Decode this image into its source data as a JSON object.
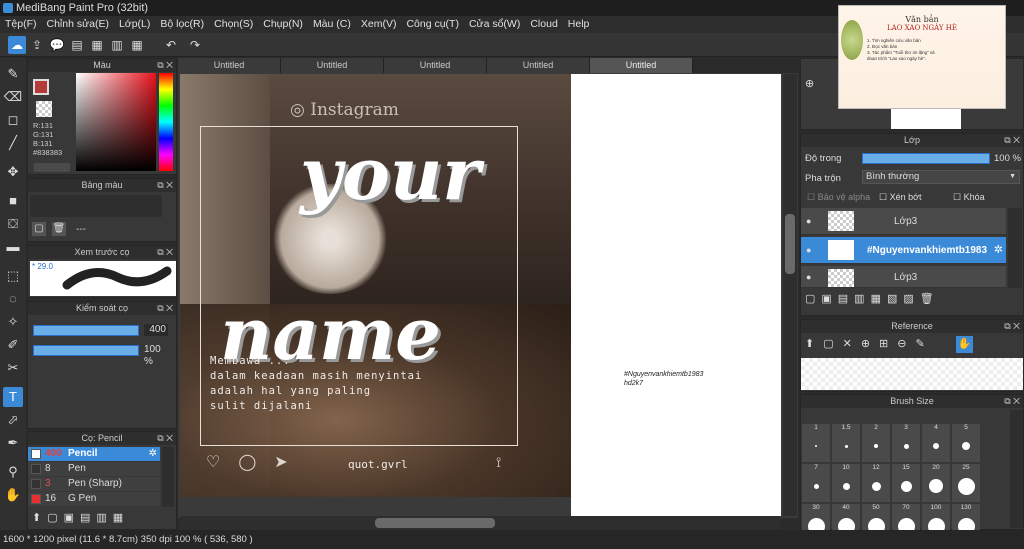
{
  "app": {
    "title": "MediBang Paint Pro (32bit)"
  },
  "menu": [
    "Tệp(F)",
    "Chỉnh sửa(E)",
    "Lớp(L)",
    "Bộ lọc(R)",
    "Chọn(S)",
    "Chụp(N)",
    "Màu (C)",
    "Xem(V)",
    "Công cụ(T)",
    "Cửa sổ(W)",
    "Cloud",
    "Help"
  ],
  "tabs": [
    "Untitled",
    "Untitled",
    "Untitled",
    "Untitled",
    "Untitled"
  ],
  "color_panel": {
    "title": "Màu",
    "r": "R:131",
    "g": "G:131",
    "b": "B:131",
    "hex": "#838383",
    "color": "#838383"
  },
  "palette_panel": {
    "title": "Bảng màu",
    "dashes": "---"
  },
  "preview_panel": {
    "title": "Xem trước cọ",
    "size": "29.0"
  },
  "control_panel": {
    "title": "Kiểm soát cọ",
    "size": "400",
    "opacity": "100 %"
  },
  "brush_panel": {
    "title": "Cọ: Pencil",
    "items": [
      {
        "size": "400",
        "name": "Pencil",
        "color": "#ffffff",
        "active": true
      },
      {
        "size": "8",
        "name": "Pen",
        "color": "#ffffff",
        "active": false
      },
      {
        "size": "3",
        "name": "Pen (Sharp)",
        "color": "#ffffff",
        "active": false
      },
      {
        "size": "16",
        "name": "G Pen",
        "color": "#e83030",
        "active": false
      }
    ]
  },
  "canvas": {
    "instagram": "Instagram",
    "word1": "your",
    "word2": "name",
    "quote": [
      "Membawa  ...",
      "dalam  keadaan  masih  menyintai",
      "adalah  hal  yang  paling",
      "sulit  dijalani"
    ],
    "handle": "quot.gvrl",
    "note": [
      "#Nguyenvankhiemtb1983",
      "hd2k7"
    ]
  },
  "layer_panel": {
    "title": "Lớp",
    "opacity_label": "Độ trong",
    "opacity": "100 %",
    "blend_label": "Pha trộn",
    "blend": "Bình thường",
    "protect": "Bảo vệ alpha",
    "clip": "Xén bớt",
    "lock": "Khóa",
    "layers": [
      {
        "name": "Lớp3",
        "active": false
      },
      {
        "name": "#Nguyenvankhiemtb1983",
        "active": true
      },
      {
        "name": "Lớp3",
        "active": false
      }
    ]
  },
  "reference_panel": {
    "title": "Reference"
  },
  "brushsize_panel": {
    "title": "Brush Size",
    "row1": [
      "1",
      "1.5",
      "2",
      "3",
      "4",
      "5"
    ],
    "row2": [
      "7",
      "10",
      "12",
      "15",
      "20",
      "25"
    ],
    "row3": [
      "30",
      "40",
      "50",
      "70",
      "100",
      "130"
    ]
  },
  "popup": {
    "title": "Văn bản",
    "subtitle": "LAO XAO NGÀY HÈ",
    "lines": [
      "1. Tìm nghiên cứu văn bản",
      "2. Đọc văn bản",
      "3. Tác phẩm \"Tuổi thơ im lặng\" và",
      "đoạn trích \"Lao xao ngày hè\"."
    ]
  },
  "status": {
    "dims": "1600 * 1200 pixel",
    "cm": "(11.6 * 8.7cm)",
    "dpi": "350 dpi",
    "zoom": "100 %",
    "coords": "( 536, 580 )"
  }
}
